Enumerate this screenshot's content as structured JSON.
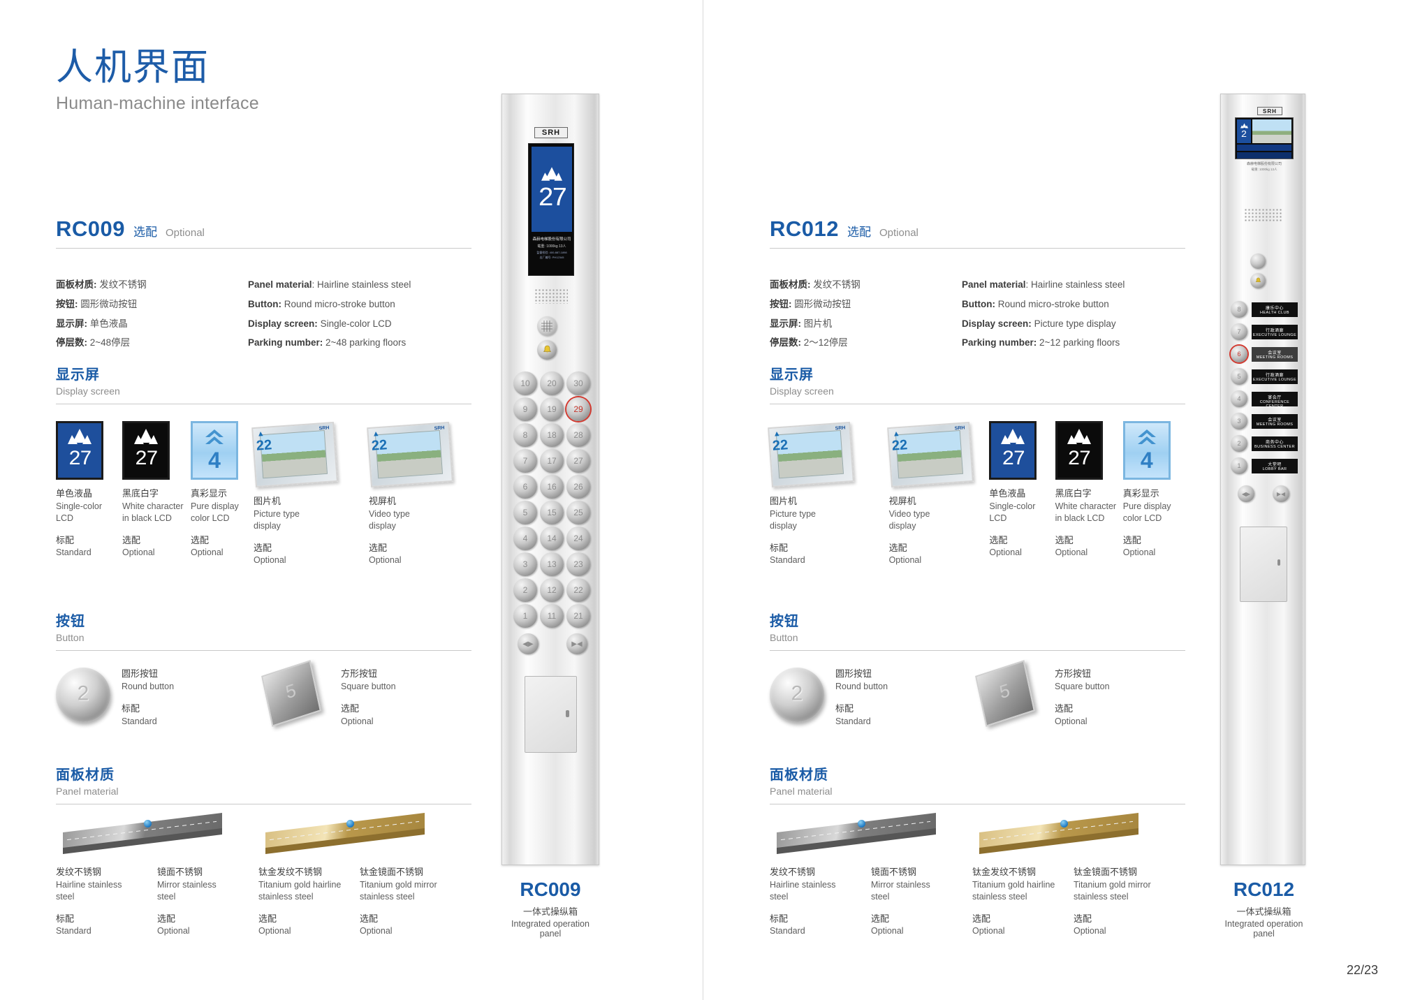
{
  "header": {
    "title_cn": "人机界面",
    "title_en": "Human-machine interface"
  },
  "page_number": "22/23",
  "labels": {
    "standard_cn": "标配",
    "standard_en": "Standard",
    "optional_cn": "选配",
    "optional_en": "Optional"
  },
  "colors": {
    "brand_blue": "#1a5ba6",
    "heading_blue": "#1d5ca8",
    "muted_grey": "#8d8d8d",
    "lcd_blue": "#1c4f9e",
    "active_red": "#d3392f"
  },
  "models": [
    {
      "code": "RC009",
      "tag_cn": "选配",
      "tag_en": "Optional",
      "specs": {
        "cn": [
          {
            "label": "面板材质:",
            "value": "发纹不锈钢"
          },
          {
            "label": "按钮:",
            "value": "圆形微动按钮"
          },
          {
            "label": "显示屏:",
            "value": "单色液晶"
          },
          {
            "label": "停层数:",
            "value": "2~48停层"
          }
        ],
        "en": [
          {
            "label": "Panel material",
            "value": ": Hairline stainless steel"
          },
          {
            "label": "Button:",
            "value": " Round micro-stroke button"
          },
          {
            "label": "Display screen:",
            "value": " Single-color LCD"
          },
          {
            "label": "Parking number:",
            "value": " 2~48 parking floors"
          }
        ]
      },
      "display_section": {
        "title_cn": "显示屏",
        "title_en": "Display screen",
        "items": [
          {
            "name_cn": "单色液晶",
            "name_en_1": "Single-color",
            "name_en_2": "LCD",
            "avail_cn": "标配",
            "avail_en": "Standard",
            "kind": "lcd-blue",
            "value": "27"
          },
          {
            "name_cn": "黑底白字",
            "name_en_1": "White character",
            "name_en_2": "in black LCD",
            "avail_cn": "选配",
            "avail_en": "Optional",
            "kind": "lcd-black",
            "value": "27"
          },
          {
            "name_cn": "真彩显示",
            "name_en_1": "Pure display",
            "name_en_2": "color LCD",
            "avail_cn": "选配",
            "avail_en": "Optional",
            "kind": "lcd-pure",
            "value": "4"
          },
          {
            "name_cn": "图片机",
            "name_en_1": "Picture type",
            "name_en_2": "display",
            "avail_cn": "选配",
            "avail_en": "Optional",
            "kind": "photo",
            "value": "22"
          },
          {
            "name_cn": "视屏机",
            "name_en_1": "Video type",
            "name_en_2": "display",
            "avail_cn": "选配",
            "avail_en": "Optional",
            "kind": "photo",
            "value": "22"
          }
        ]
      },
      "button_section": {
        "title_cn": "按钮",
        "title_en": "Button",
        "items": [
          {
            "name_cn": "圆形按钮",
            "name_en": "Round button",
            "avail_cn": "标配",
            "avail_en": "Standard",
            "kind": "round",
            "value": "2"
          },
          {
            "name_cn": "方形按钮",
            "name_en": "Square button",
            "avail_cn": "选配",
            "avail_en": "Optional",
            "kind": "square",
            "value": "5"
          }
        ]
      },
      "panel_section": {
        "title_cn": "面板材质",
        "title_en": "Panel material",
        "items": [
          {
            "name_cn": "发纹不锈钢",
            "name_en_1": "Hairline stainless",
            "name_en_2": "steel",
            "avail_cn": "标配",
            "avail_en": "Standard",
            "kind": "steel"
          },
          {
            "name_cn": "镜面不锈钢",
            "name_en_1": "Mirror stainless",
            "name_en_2": "steel",
            "avail_cn": "选配",
            "avail_en": "Optional",
            "kind": "steel"
          },
          {
            "name_cn": "钛金发纹不锈钢",
            "name_en_1": "Titanium gold hairline",
            "name_en_2": "stainless steel",
            "avail_cn": "选配",
            "avail_en": "Optional",
            "kind": "gold"
          },
          {
            "name_cn": "钛金镜面不锈钢",
            "name_en_1": "Titanium gold mirror",
            "name_en_2": "stainless steel",
            "avail_cn": "选配",
            "avail_en": "Optional",
            "kind": "gold"
          }
        ]
      },
      "cop": {
        "code": "RC009",
        "caption_cn": "一体式操纵箱",
        "caption_en": "Integrated operation panel",
        "brand": "SRH",
        "display_value": "27",
        "info_line_1": "森赫电梯股份有限公司",
        "info_line_2": "载重: 1000kg          13人",
        "info_line_3": "监督检验: 400-887-1898",
        "info_line_4": "出厂编号: PH12345",
        "active_button": "29",
        "floor_columns": [
          [
            "10",
            "9",
            "8",
            "7",
            "6",
            "5",
            "4",
            "3",
            "2",
            "1"
          ],
          [
            "20",
            "19",
            "18",
            "17",
            "16",
            "15",
            "14",
            "13",
            "12",
            "11"
          ],
          [
            "30",
            "29",
            "28",
            "27",
            "26",
            "25",
            "24",
            "23",
            "22",
            "21"
          ]
        ],
        "door_buttons": [
          "◀▶",
          "▶◀"
        ]
      }
    },
    {
      "code": "RC012",
      "tag_cn": "选配",
      "tag_en": "Optional",
      "specs": {
        "cn": [
          {
            "label": "面板材质:",
            "value": "发纹不锈钢"
          },
          {
            "label": "按钮:",
            "value": "圆形微动按钮"
          },
          {
            "label": "显示屏:",
            "value": "图片机"
          },
          {
            "label": "停层数:",
            "value": "2～12停层"
          }
        ],
        "en": [
          {
            "label": "Panel material",
            "value": ": Hairline stainless steel"
          },
          {
            "label": "Button:",
            "value": " Round micro-stroke button"
          },
          {
            "label": "Display screen:",
            "value": " Picture type display"
          },
          {
            "label": "Parking number:",
            "value": " 2~12 parking floors"
          }
        ]
      },
      "display_section": {
        "title_cn": "显示屏",
        "title_en": "Display screen",
        "items": [
          {
            "name_cn": "图片机",
            "name_en_1": "Picture type",
            "name_en_2": "display",
            "avail_cn": "标配",
            "avail_en": "Standard",
            "kind": "photo",
            "value": "22"
          },
          {
            "name_cn": "视屏机",
            "name_en_1": "Video type",
            "name_en_2": "display",
            "avail_cn": "选配",
            "avail_en": "Optional",
            "kind": "photo",
            "value": "22"
          },
          {
            "name_cn": "单色液晶",
            "name_en_1": "Single-color",
            "name_en_2": "LCD",
            "avail_cn": "选配",
            "avail_en": "Optional",
            "kind": "lcd-blue",
            "value": "27"
          },
          {
            "name_cn": "黑底白字",
            "name_en_1": "White character",
            "name_en_2": "in black LCD",
            "avail_cn": "选配",
            "avail_en": "Optional",
            "kind": "lcd-black",
            "value": "27"
          },
          {
            "name_cn": "真彩显示",
            "name_en_1": "Pure display",
            "name_en_2": "color LCD",
            "avail_cn": "选配",
            "avail_en": "Optional",
            "kind": "lcd-pure",
            "value": "4"
          }
        ]
      },
      "button_section": {
        "title_cn": "按钮",
        "title_en": "Button",
        "items": [
          {
            "name_cn": "圆形按钮",
            "name_en": "Round button",
            "avail_cn": "标配",
            "avail_en": "Standard",
            "kind": "round",
            "value": "2"
          },
          {
            "name_cn": "方形按钮",
            "name_en": "Square button",
            "avail_cn": "选配",
            "avail_en": "Optional",
            "kind": "square",
            "value": "5"
          }
        ]
      },
      "panel_section": {
        "title_cn": "面板材质",
        "title_en": "Panel material",
        "items": [
          {
            "name_cn": "发纹不锈钢",
            "name_en_1": "Hairline stainless",
            "name_en_2": "steel",
            "avail_cn": "标配",
            "avail_en": "Standard",
            "kind": "steel"
          },
          {
            "name_cn": "镜面不锈钢",
            "name_en_1": "Mirror stainless",
            "name_en_2": "steel",
            "avail_cn": "选配",
            "avail_en": "Optional",
            "kind": "steel"
          },
          {
            "name_cn": "钛金发纹不锈钢",
            "name_en_1": "Titanium gold hairline",
            "name_en_2": "stainless steel",
            "avail_cn": "选配",
            "avail_en": "Optional",
            "kind": "gold"
          },
          {
            "name_cn": "钛金镜面不锈钢",
            "name_en_1": "Titanium gold mirror",
            "name_en_2": "stainless steel",
            "avail_cn": "选配",
            "avail_en": "Optional",
            "kind": "gold"
          }
        ]
      },
      "cop": {
        "code": "RC012",
        "caption_cn": "一体式操纵箱",
        "caption_en": "Integrated operation panel",
        "brand": "SRH",
        "display_value": "2",
        "info_line_1": "森赫电梯股份有限公司",
        "info_line_2": "载重: 1000kg     13人",
        "active_button": "6",
        "floor_plates": [
          {
            "floor": "8",
            "cn": "康乐中心",
            "en": "HEALTH CLUB",
            "highlight": false
          },
          {
            "floor": "7",
            "cn": "行政酒廊",
            "en": "EXECUTIVE LOUNGE",
            "highlight": false
          },
          {
            "floor": "6",
            "cn": "会议室",
            "en": "MEETING ROOMS",
            "highlight": true
          },
          {
            "floor": "5",
            "cn": "行政酒廊",
            "en": "EXECUTIVE LOUNGE",
            "highlight": false
          },
          {
            "floor": "4",
            "cn": "宴会厅",
            "en": "CONFERENCE CENTER",
            "highlight": false
          },
          {
            "floor": "3",
            "cn": "会议室",
            "en": "MEETING ROOMS",
            "highlight": false
          },
          {
            "floor": "2",
            "cn": "商务中心",
            "en": "BUSINESS CENTER",
            "highlight": false
          },
          {
            "floor": "1",
            "cn": "大堂吧",
            "en": "LOBBY BAR",
            "highlight": false
          }
        ],
        "door_buttons": [
          "◀▶",
          "▶◀"
        ]
      }
    }
  ]
}
